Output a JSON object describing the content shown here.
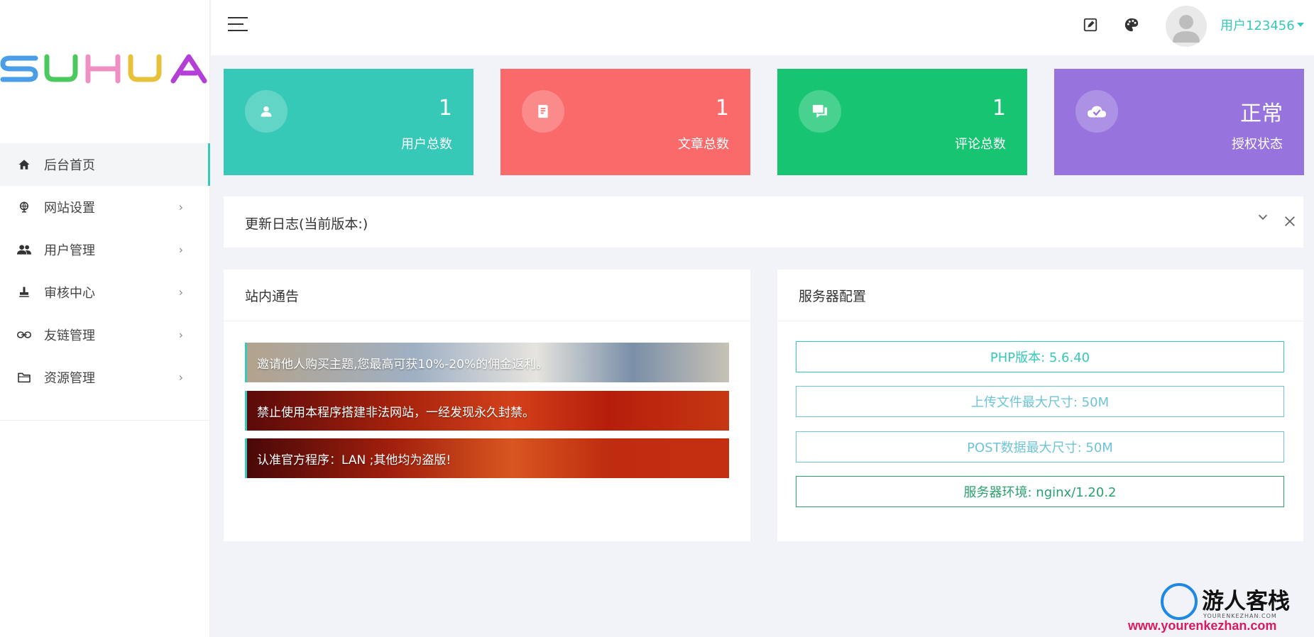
{
  "brand": {
    "logo_text": "SUHUA"
  },
  "sidebar": {
    "items": [
      {
        "label": "后台首页",
        "icon": "home-icon",
        "active": true,
        "has_children": false
      },
      {
        "label": "网站设置",
        "icon": "globe-icon",
        "active": false,
        "has_children": true
      },
      {
        "label": "用户管理",
        "icon": "users-icon",
        "active": false,
        "has_children": true
      },
      {
        "label": "审核中心",
        "icon": "stamp-icon",
        "active": false,
        "has_children": true
      },
      {
        "label": "友链管理",
        "icon": "link-icon",
        "active": false,
        "has_children": true
      },
      {
        "label": "资源管理",
        "icon": "folder-icon",
        "active": false,
        "has_children": true
      }
    ]
  },
  "header": {
    "user_name": "用户123456",
    "icons": [
      "edit-icon",
      "palette-icon"
    ]
  },
  "stats": [
    {
      "value": "1",
      "label": "用户总数",
      "icon": "user-icon",
      "color": "#36c9b8"
    },
    {
      "value": "1",
      "label": "文章总数",
      "icon": "article-icon",
      "color": "#fa6a6a"
    },
    {
      "value": "1",
      "label": "评论总数",
      "icon": "comment-icon",
      "color": "#17c471"
    },
    {
      "value": "正常",
      "label": "授权状态",
      "icon": "cloud-check-icon",
      "color": "#9773de"
    }
  ],
  "update_log": {
    "title": "更新日志(当前版本:)"
  },
  "notices": {
    "title": "站内通告",
    "items": [
      "邀请他人购买主题,您最高可获10%-20%的佣金返利。",
      "禁止使用本程序搭建非法网站，一经发现永久封禁。",
      "认准官方程序：LAN ;其他均为盗版!"
    ]
  },
  "server": {
    "title": "服务器配置",
    "items": [
      "PHP版本: 5.6.40",
      "上传文件最大尺寸: 50M",
      "POST数据最大尺寸: 50M",
      "服务器环境: nginx/1.20.2"
    ]
  },
  "watermark": {
    "title": "游人客栈",
    "subtitle": "YOURENKEZHAN.COM",
    "url": "www.yourenkezhan.com"
  },
  "colors": {
    "accent": "#36c9b8",
    "bg": "#f2f3f8"
  }
}
